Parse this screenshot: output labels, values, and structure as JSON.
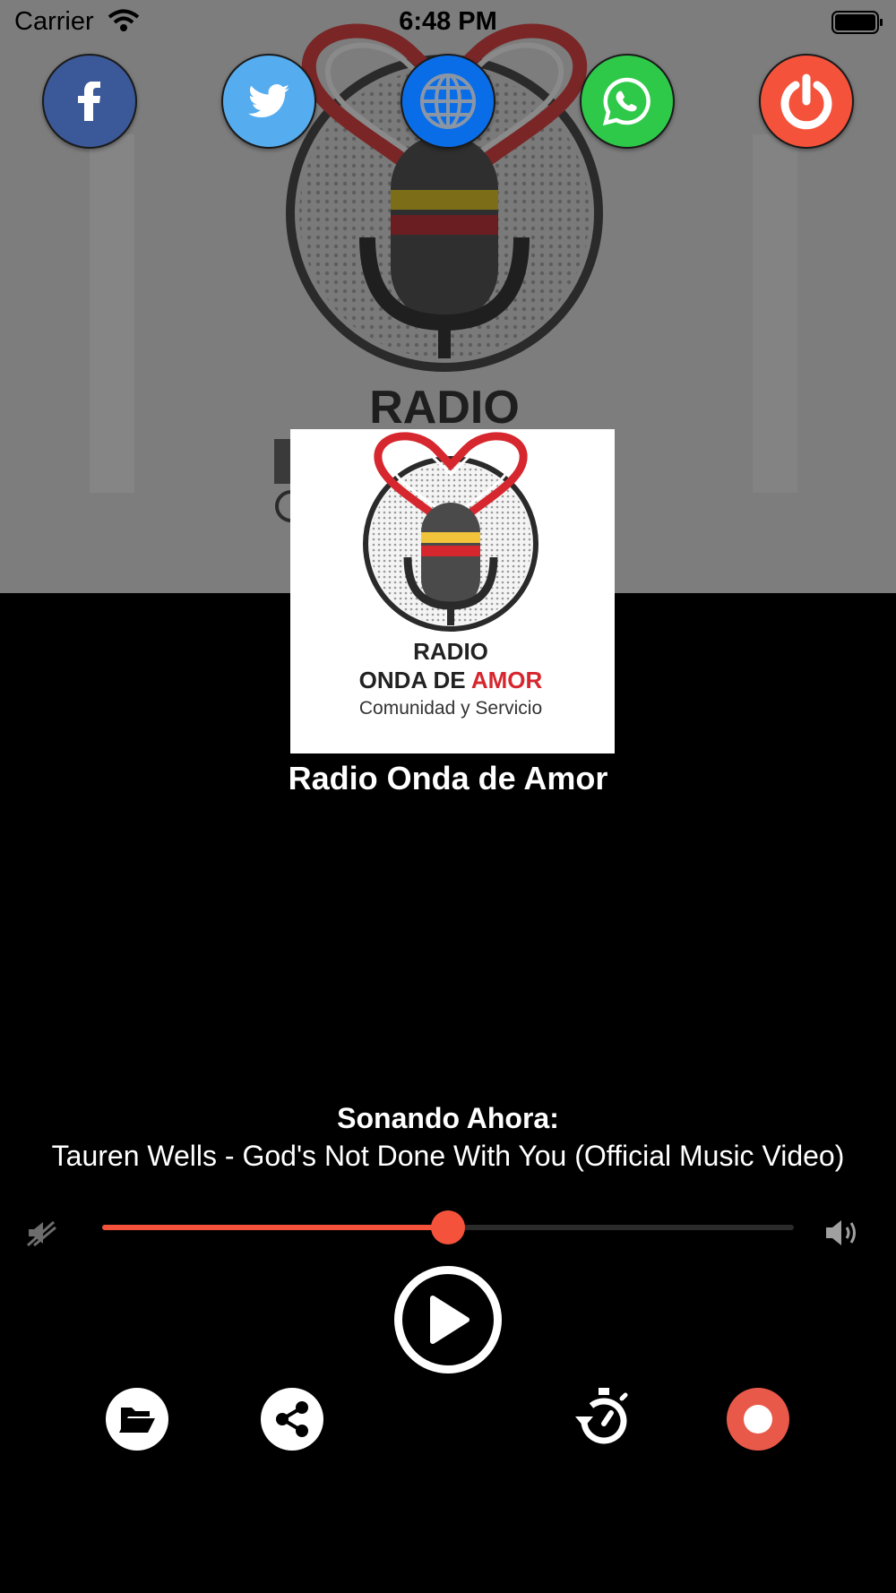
{
  "status_bar": {
    "carrier": "Carrier",
    "time": "6:48 PM"
  },
  "hero": {
    "background_logo_text": "RADIO"
  },
  "social": [
    {
      "name": "facebook",
      "icon": "facebook-icon",
      "color": "#3b5998"
    },
    {
      "name": "twitter",
      "icon": "twitter-icon",
      "color": "#55acee"
    },
    {
      "name": "website",
      "icon": "globe-icon",
      "color": "#0a6de8"
    },
    {
      "name": "whatsapp",
      "icon": "whatsapp-icon",
      "color": "#2fc94a"
    },
    {
      "name": "power",
      "icon": "power-icon",
      "color": "#f4523b"
    }
  ],
  "station": {
    "logo_line1": "RADIO",
    "logo_line2_a": "ONDA DE ",
    "logo_line2_b": "AMOR",
    "logo_line3": "Comunidad y Servicio",
    "name": "Radio Onda de Amor"
  },
  "now_playing": {
    "label": "Sonando Ahora:",
    "track": "Tauren Wells - God's Not Done With You (Official Music Video)"
  },
  "volume": {
    "level": 0.5,
    "accent_color": "#f4523b",
    "min_icon": "volume-mute-icon",
    "max_icon": "volume-high-icon"
  },
  "controls": {
    "play_icon": "play-icon",
    "actions": [
      "folder-icon",
      "share-icon",
      "timer-icon",
      "record-icon"
    ]
  }
}
